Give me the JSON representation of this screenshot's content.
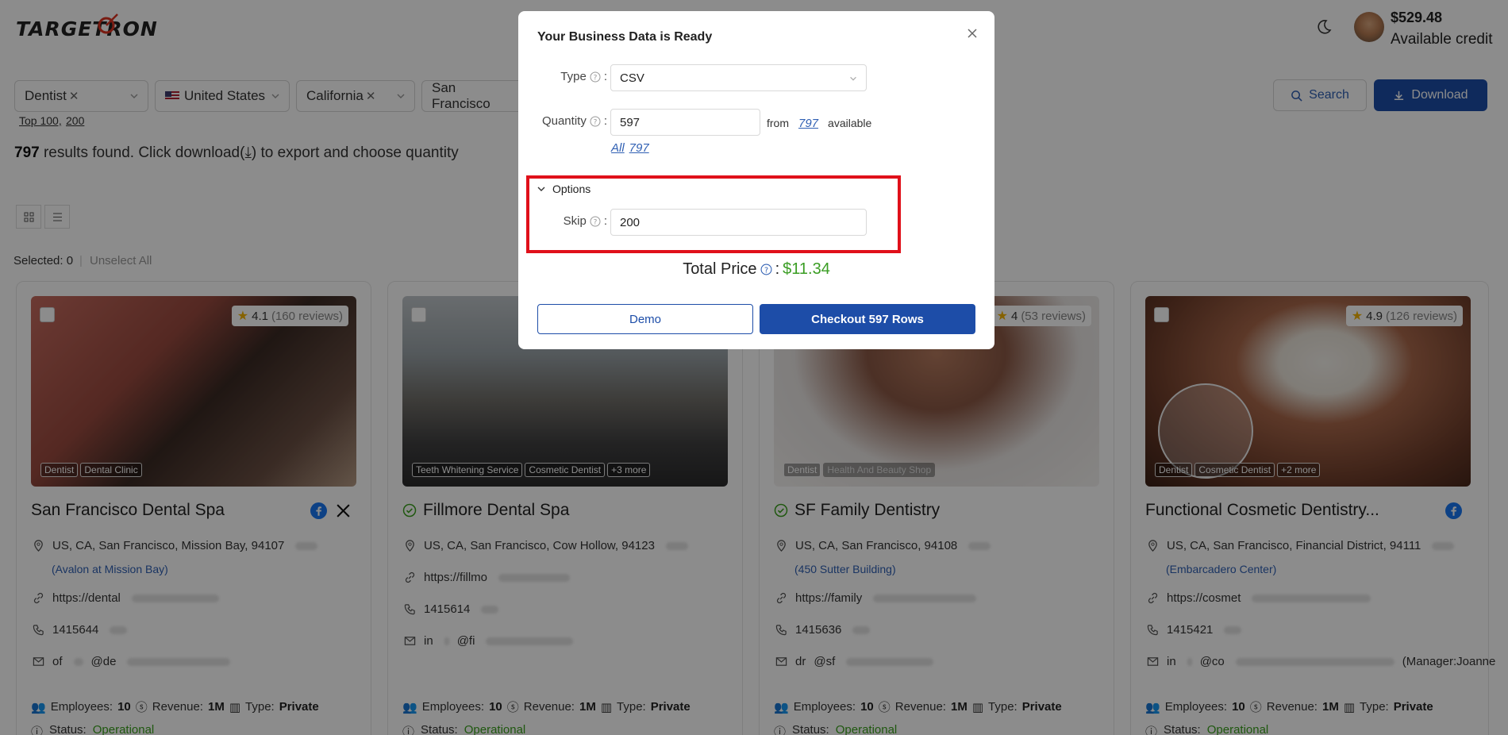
{
  "header": {
    "logo": "TARGETRON",
    "credit_amount": "$529.48",
    "credit_label": "Available credit"
  },
  "filters": [
    {
      "label": "Dentist",
      "removable": true
    },
    {
      "label": "United States",
      "flag": "us"
    },
    {
      "label": "California",
      "removable": true
    },
    {
      "label": "San Francisco",
      "removable": true
    }
  ],
  "suggestions": [
    "Top 100,",
    "200"
  ],
  "actions": {
    "search": "Search",
    "download": "Download"
  },
  "results": {
    "count": "797",
    "text": "results found. Click download(⤓) to export and choose quantity"
  },
  "selection": {
    "selected": "Selected: 0",
    "separator": "|",
    "unselect": "Unselect All"
  },
  "cards": [
    {
      "title": "San Francisco Dental Spa",
      "rating": "4.1",
      "reviews": "(160 reviews)",
      "tags": [
        "Dentist",
        "Dental Clinic"
      ],
      "address": "US, CA, San Francisco, Mission Bay, 94107",
      "sub": "(Avalon at Mission Bay)",
      "website": "https://dental",
      "phone": "1415644",
      "email": "of",
      "email2": "@de",
      "emp_label": "Employees:",
      "employees": "10",
      "rev_label": "Revenue:",
      "revenue": "1M",
      "type_label": "Type:",
      "type": "Private",
      "status_label": "Status:",
      "status": "Operational",
      "social": [
        "facebook",
        "x"
      ]
    },
    {
      "title": "Fillmore Dental Spa",
      "rating": "",
      "reviews": "",
      "tags": [
        "Teeth Whitening Service",
        "Cosmetic Dentist",
        "+3 more"
      ],
      "address": "US, CA, San Francisco, Cow Hollow, 94123",
      "sub": "",
      "website": "https://fillmo",
      "phone": "1415614",
      "email": "in",
      "email2": "@fi",
      "emp_label": "Employees:",
      "employees": "10",
      "rev_label": "Revenue:",
      "revenue": "1M",
      "type_label": "Type:",
      "type": "Private",
      "status_label": "Status:",
      "status": "Operational",
      "social": []
    },
    {
      "title": "SF Family Dentistry",
      "rating": "4",
      "reviews": "(53 reviews)",
      "tags": [
        "Dentist",
        "Health And Beauty Shop"
      ],
      "address": "US, CA, San Francisco, 94108",
      "sub": "(450 Sutter Building)",
      "website": "https://family",
      "phone": "1415636",
      "email": "dr",
      "email2": "@sf",
      "emp_label": "Employees:",
      "employees": "10",
      "rev_label": "Revenue:",
      "revenue": "1M",
      "type_label": "Type:",
      "type": "Private",
      "status_label": "Status:",
      "status": "Operational",
      "social": []
    },
    {
      "title": "Functional Cosmetic Dentistry...",
      "rating": "4.9",
      "reviews": "(126 reviews)",
      "tags": [
        "Dentist",
        "Cosmetic Dentist",
        "+2 more"
      ],
      "address": "US, CA, San Francisco, Financial District, 94111",
      "sub": "(Embarcadero Center)",
      "website": "https://cosmet",
      "phone": "1415421",
      "email": "in",
      "email2": "@co",
      "email_tail": "(Manager:Joanne",
      "emp_label": "Employees:",
      "employees": "10",
      "rev_label": "Revenue:",
      "revenue": "1M",
      "type_label": "Type:",
      "type": "Private",
      "status_label": "Status:",
      "status": "Operational",
      "social": [
        "facebook"
      ]
    }
  ],
  "modal": {
    "title": "Your Business Data is Ready",
    "type_label": "Type",
    "type_value": "CSV",
    "quantity_label": "Quantity",
    "quantity_value": "597",
    "from_text": "from",
    "available_count": "797",
    "available_text": "available",
    "all_label": "All",
    "all_count": "797",
    "options_label": "Options",
    "skip_label": "Skip",
    "skip_value": "200",
    "total_label": "Total Price",
    "total_value": "$11.34",
    "demo_button": "Demo",
    "checkout_button": "Checkout 597 Rows"
  },
  "colors": {
    "primary": "#1d4da8",
    "link": "#2f5fb3",
    "price": "#3a9d23",
    "highlight": "#e0101a",
    "status": "#3aa01d"
  }
}
